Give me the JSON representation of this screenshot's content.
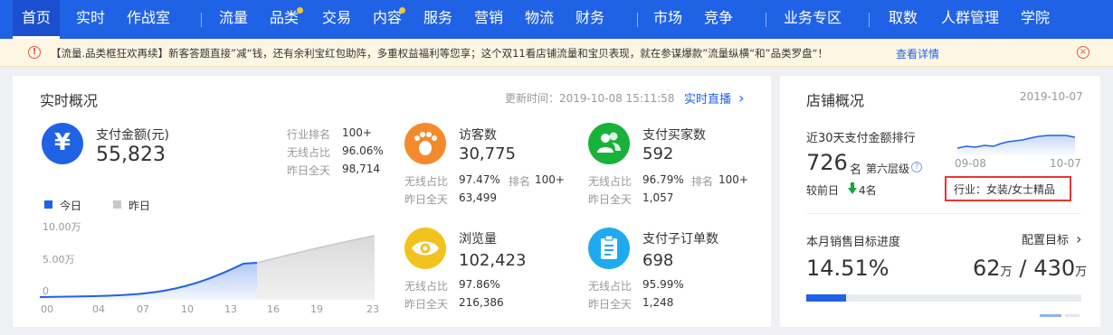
{
  "nav": {
    "items": [
      {
        "label": "首页",
        "active": true
      },
      {
        "label": "实时"
      },
      {
        "label": "作战室"
      },
      {
        "label": "流量"
      },
      {
        "label": "品类",
        "dot": true
      },
      {
        "label": "交易"
      },
      {
        "label": "内容",
        "dot": true
      },
      {
        "label": "服务"
      },
      {
        "label": "营销"
      },
      {
        "label": "物流"
      },
      {
        "label": "财务"
      },
      {
        "label": "市场"
      },
      {
        "label": "竞争"
      },
      {
        "label": "业务专区"
      },
      {
        "label": "取数"
      },
      {
        "label": "人群管理"
      },
      {
        "label": "学院"
      }
    ]
  },
  "notice": {
    "icon": "!",
    "text": "【流量.品类框狂欢再续】新客答题直接”减“钱，还有余利宝红包助阵，多重权益福利等您享；这个双11看店铺流量和宝贝表现，就在参谋爆款”流量纵横“和”品类罗盘“！",
    "link": "查看详情",
    "close_icon": "×"
  },
  "realtime": {
    "title": "实时概况",
    "update_label": "更新时间：2019-10-08 15:11:58",
    "live_link": "实时直播",
    "live_chevron": "›",
    "pay": {
      "icon_glyph": "¥",
      "label": "支付金额(元)",
      "value": "55,823",
      "rows": [
        {
          "k": "行业排名",
          "v": "100+"
        },
        {
          "k": "无线占比",
          "v": "96.06%"
        },
        {
          "k": "昨日全天",
          "v": "98,714"
        }
      ]
    },
    "legend": {
      "today": "今日",
      "yesterday": "昨日"
    },
    "chart": {
      "y_ticks": [
        "10.00万",
        "5.00万",
        "0"
      ],
      "x_ticks": [
        "00",
        "04",
        "07",
        "10",
        "13",
        "16",
        "19",
        "23"
      ]
    },
    "metrics": [
      {
        "label": "访客数",
        "value": "30,775",
        "line1_k": "无线占比",
        "line1_v": "97.47%",
        "rank_k": "排名",
        "rank_v": "100+",
        "line2_k": "昨日全天",
        "line2_v": "63,499",
        "color": "#f58a2d",
        "icon": "footprint-icon"
      },
      {
        "label": "支付买家数",
        "value": "592",
        "line1_k": "无线占比",
        "line1_v": "96.79%",
        "rank_k": "排名",
        "rank_v": "100+",
        "line2_k": "昨日全天",
        "line2_v": "1,057",
        "color": "#18b23b",
        "icon": "users-icon"
      },
      {
        "label": "浏览量",
        "value": "102,423",
        "line1_k": "无线占比",
        "line1_v": "97.86%",
        "line2_k": "昨日全天",
        "line2_v": "216,386",
        "color": "#f2c31f",
        "icon": "eye-icon"
      },
      {
        "label": "支付子订单数",
        "value": "698",
        "line1_k": "无线占比",
        "line1_v": "95.99%",
        "line2_k": "昨日全天",
        "line2_v": "1,248",
        "color": "#1faaf0",
        "icon": "clipboard-icon"
      }
    ]
  },
  "store": {
    "title": "店铺概况",
    "date": "2019-10-07",
    "rank_title": "近30天支付金额排行",
    "rank_value": "726",
    "rank_unit": "名",
    "rank_level": "第六层级",
    "help_icon": "?",
    "compare_label": "较前日",
    "compare_value": "4名",
    "spark_start": "09-08",
    "spark_end": "10-07",
    "industry": "行业：女装/女士精品",
    "target_title": "本月销售目标进度",
    "target_link": "配置目标",
    "target_chevron": "›",
    "target_percent": "14.51%",
    "target_progress": 0.1451,
    "target_done": "62",
    "target_done_unit": "万",
    "target_sep": "/",
    "target_total": "430",
    "target_total_unit": "万"
  },
  "colors": {
    "brand": "#2062e6",
    "today_line": "#2062e6",
    "yesterday_line": "#c8c8c8",
    "up_arrow": "#18a53b",
    "highlight_box": "#e33333"
  }
}
